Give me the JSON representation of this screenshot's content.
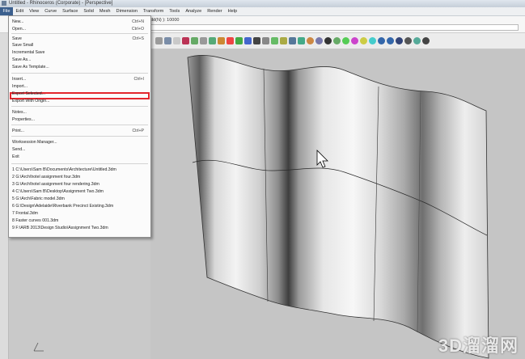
{
  "titlebar": {
    "text": "Untitled - Rhinoceros (Corporate) - [Perspective]"
  },
  "menubar": {
    "items": [
      "File",
      "Edit",
      "View",
      "Curve",
      "Surface",
      "Solid",
      "Mesh",
      "Dimension",
      "Transform",
      "Tools",
      "Analyze",
      "Render",
      "Help"
    ]
  },
  "command": {
    "line": "dd(N) ): 10000"
  },
  "file_menu": {
    "items": [
      {
        "label": "New...",
        "shortcut": "Ctrl+N"
      },
      {
        "label": "Open...",
        "shortcut": "Ctrl+O"
      },
      {
        "label": "Save",
        "shortcut": "Ctrl+S"
      },
      {
        "label": "Save Small",
        "shortcut": ""
      },
      {
        "label": "Incremental Save",
        "shortcut": ""
      },
      {
        "label": "Save As...",
        "shortcut": ""
      },
      {
        "label": "Save As Template...",
        "shortcut": ""
      },
      {
        "label": "Insert...",
        "shortcut": "Ctrl+I"
      },
      {
        "label": "Import...",
        "shortcut": ""
      },
      {
        "label": "Export Selected...",
        "shortcut": ""
      },
      {
        "label": "Export With Origin...",
        "shortcut": ""
      },
      {
        "label": "Notes...",
        "shortcut": ""
      },
      {
        "label": "Properties...",
        "shortcut": ""
      },
      {
        "label": "Print...",
        "shortcut": "Ctrl+P"
      },
      {
        "label": "Worksession Manager...",
        "shortcut": ""
      },
      {
        "label": "Send...",
        "shortcut": ""
      },
      {
        "label": "Exit",
        "shortcut": ""
      },
      {
        "label": "1 C:\\Users\\Sam B\\Documents\\Architecture\\Untitled.3dm",
        "shortcut": ""
      },
      {
        "label": "2 G:\\Arch\\hotel assignment four.3dm",
        "shortcut": ""
      },
      {
        "label": "3 G:\\Arch\\hotel assignment four rendering.3dm",
        "shortcut": ""
      },
      {
        "label": "4 C:\\Users\\Sam B\\Desktop\\Assignment Two.3dm",
        "shortcut": ""
      },
      {
        "label": "5 G:\\Arch\\Fabric model.3dm",
        "shortcut": ""
      },
      {
        "label": "6 G:\\Design\\Adelaide\\Riverbank Precinct Existing.3dm",
        "shortcut": ""
      },
      {
        "label": "7 Frontal.3dm",
        "shortcut": ""
      },
      {
        "label": "8 Faster curves 001.3dm",
        "shortcut": ""
      },
      {
        "label": "9 F:\\ARB 2013\\Design Studio\\Assignment Two.3dm",
        "shortcut": ""
      }
    ]
  },
  "watermark": "3D溜溜网",
  "colors": {
    "highlight": "#e3262d",
    "menu_active": "#3b5f8e"
  }
}
